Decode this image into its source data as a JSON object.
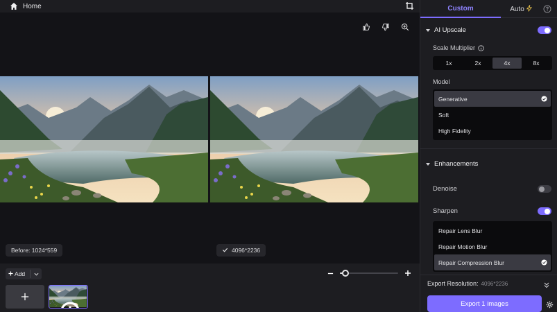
{
  "topbar": {
    "title": "Home"
  },
  "preview": {
    "before_label": "Before: 1024*559",
    "after_label": "4096*2236"
  },
  "bottombar": {
    "add_label": "Add",
    "zoom_level": 0.1
  },
  "panel": {
    "tabs": [
      {
        "label": "Custom",
        "active": true
      },
      {
        "label": "Auto",
        "active": false
      }
    ],
    "ai_upscale": {
      "title": "AI Upscale",
      "enabled": true,
      "scale_label": "Scale Multiplier",
      "scale_options": [
        "1x",
        "2x",
        "4x",
        "8x"
      ],
      "scale_selected": "4x",
      "model_label": "Model",
      "models": [
        "Generative",
        "Soft",
        "High Fidelity"
      ],
      "model_selected": "Generative"
    },
    "enhancements": {
      "title": "Enhancements",
      "denoise_label": "Denoise",
      "denoise_enabled": false,
      "sharpen_label": "Sharpen",
      "sharpen_enabled": true,
      "sharpen_options": [
        "Repair Lens Blur",
        "Repair Motion Blur",
        "Repair Compression Blur"
      ],
      "sharpen_selected": "Repair Compression Blur"
    },
    "export": {
      "resolution_label": "Export Resolution:",
      "resolution_value": "4096*2236",
      "button_label": "Export 1 images"
    }
  },
  "colors": {
    "accent": "#7d6cff",
    "panel": "#1d1d21",
    "stage": "#131317"
  }
}
